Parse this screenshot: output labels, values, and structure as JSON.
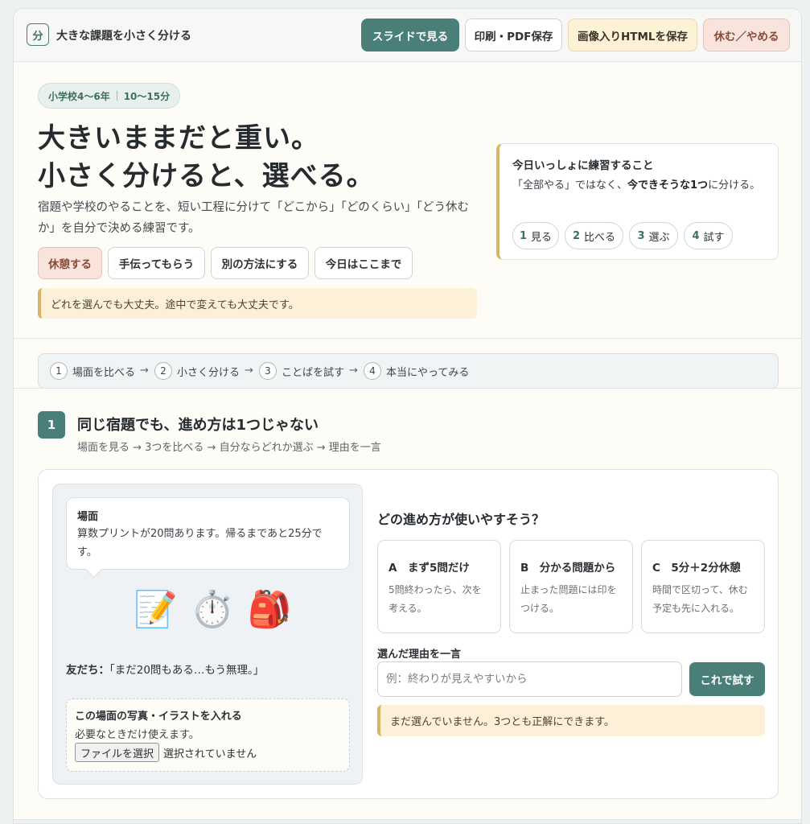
{
  "header": {
    "logo_char": "分",
    "app_title": "大きな課題を小さく分ける",
    "buttons": {
      "slides": "スライドで見る",
      "print": "印刷・PDF保存",
      "save_html": "画像入りHTMLを保存",
      "stop": "休む／やめる"
    }
  },
  "hero": {
    "badge_grade": "小学校4〜6年",
    "badge_time": "10〜15分",
    "title_line1": "大きいままだと重い。",
    "title_line2": "小さく分けると、選べる。",
    "description": "宿題や学校のやることを、短い工程に分けて「どこから」「どのくらい」「どう休むか」を自分で決める練習です。",
    "actions": {
      "rest": "休憩する",
      "help": "手伝ってもらう",
      "other": "別の方法にする",
      "done": "今日はここまで"
    },
    "note": "どれを選んでも大丈夫。途中で変えても大丈夫です。"
  },
  "today": {
    "title": "今日いっしょに練習すること",
    "desc_before": "「全部やる」ではなく、",
    "desc_bold": "今できそうな1つ",
    "desc_after": "に分ける。",
    "steps": [
      {
        "num": "1",
        "label": "見る"
      },
      {
        "num": "2",
        "label": "比べる"
      },
      {
        "num": "3",
        "label": "選ぶ"
      },
      {
        "num": "4",
        "label": "試す"
      }
    ]
  },
  "stepnav": {
    "items": [
      {
        "num": "1",
        "label": "場面を比べる"
      },
      {
        "num": "2",
        "label": "小さく分ける"
      },
      {
        "num": "3",
        "label": "ことばを試す"
      },
      {
        "num": "4",
        "label": "本当にやってみる"
      }
    ],
    "arrow": "→"
  },
  "section1": {
    "num": "1",
    "title": "同じ宿題でも、進め方は1つじゃない",
    "subtitle": "場面を見る → 3つを比べる → 自分ならどれか選ぶ → 理由を一言",
    "scene": {
      "title": "場面",
      "text": "算数プリントが20問あります。帰るまであと25分です。",
      "emojis": [
        "📝",
        "⏱️",
        "🎒"
      ],
      "friend_label": "友だち：",
      "friend_quote": "「まだ20問もある…もう無理。」",
      "upload_title": "この場面の写真・イラストを入れる",
      "upload_desc": "必要なときだけ使えます。",
      "file_button": "ファイルを選択",
      "file_status": "選択されていません"
    },
    "question": "どの進め方が使いやすそう？",
    "options": [
      {
        "title": "A　まず5問だけ",
        "desc": "5問終わったら、次を考える。"
      },
      {
        "title": "B　分かる問題から",
        "desc": "止まった問題には印をつける。"
      },
      {
        "title": "C　5分＋2分休憩",
        "desc": "時間で区切って、休む予定も先に入れる。"
      }
    ],
    "reason_label": "選んだ理由を一言",
    "reason_placeholder": "例：終わりが見えやすいから",
    "try_button": "これで試す",
    "status": "まだ選んでいません。3つとも正解にできます。"
  },
  "colors": {
    "accent": "#4a7f79",
    "warm_note": "#fdf0d8",
    "stop": "#f8e4dd"
  }
}
